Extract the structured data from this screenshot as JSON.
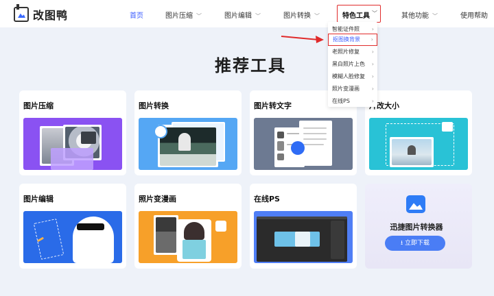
{
  "brand": {
    "name": "改图鸭"
  },
  "nav": {
    "items": [
      {
        "label": "首页"
      },
      {
        "label": "图片压缩"
      },
      {
        "label": "图片编辑"
      },
      {
        "label": "图片转换"
      },
      {
        "label": "特色工具"
      },
      {
        "label": "其他功能"
      },
      {
        "label": "使用帮助"
      }
    ],
    "active_color": "#3a5bff",
    "highlight_color": "#e02a2a"
  },
  "dropdown": {
    "items": [
      {
        "label": "智能证件照"
      },
      {
        "label": "抠图换背景"
      },
      {
        "label": "老照片修复"
      },
      {
        "label": "黑白照片上色"
      },
      {
        "label": "模糊人脸修复"
      },
      {
        "label": "照片变漫画"
      },
      {
        "label": "在线PS"
      }
    ]
  },
  "main": {
    "title": "推荐工具",
    "cards": [
      {
        "title": "图片压缩"
      },
      {
        "title": "图片转换"
      },
      {
        "title": "图片转文字"
      },
      {
        "title": "片改大小"
      },
      {
        "title": "图片编辑"
      },
      {
        "title": "照片变漫画"
      },
      {
        "title": "在线PS"
      }
    ],
    "promo": {
      "title": "迅捷图片转换器",
      "button": "立即下载"
    }
  },
  "icons": [
    "logo-icon",
    "chevron-down-icon",
    "chevron-right-icon",
    "red-arrow-icon",
    "image-icon",
    "download-icon",
    "refresh-icon",
    "expand-icon"
  ]
}
